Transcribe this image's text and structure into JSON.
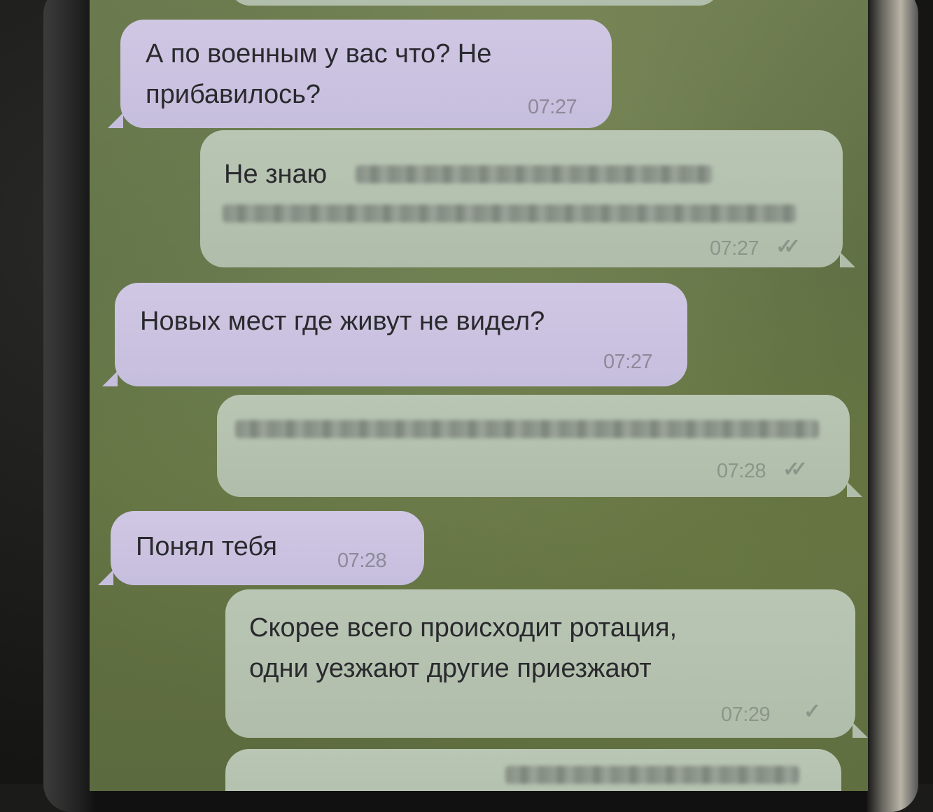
{
  "messages": [
    {
      "direction": "in",
      "text": "А по военным у вас что? Не\nприбавилось?",
      "time": "07:27"
    },
    {
      "direction": "out",
      "text": "Не знаю",
      "time": "07:27",
      "status_icon": "double-check-icon",
      "redacted": true
    },
    {
      "direction": "in",
      "text": "Новых мест где живут не видел?",
      "time": "07:27"
    },
    {
      "direction": "out",
      "text": "",
      "time": "07:28",
      "status_icon": "double-check-icon",
      "redacted": true
    },
    {
      "direction": "in",
      "text": "Понял тебя",
      "time": "07:28"
    },
    {
      "direction": "out",
      "text": "Скорее всего происходит ротация,\nодни уезжают другие приезжают",
      "time": "07:29",
      "status_icon": "single-check-icon"
    }
  ],
  "icons": {
    "double_check": "✓✓",
    "single_check": "✓"
  },
  "colors": {
    "incoming_bubble": "#c9c1df",
    "outgoing_bubble": "#b4c1af",
    "chat_background": "#62703f"
  }
}
